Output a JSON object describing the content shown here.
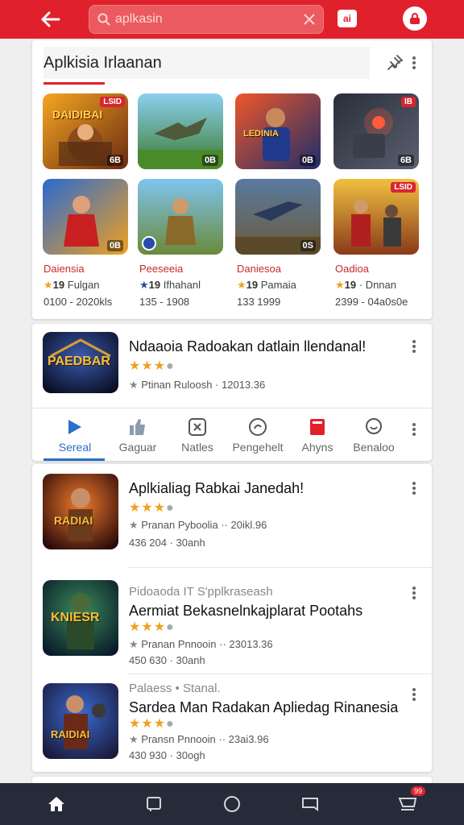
{
  "colors": {
    "brand": "#e0212b",
    "accent_blue": "#2a6fc9",
    "star": "#f0a020",
    "nav_bg": "#262b3a"
  },
  "header": {
    "back_icon": "arrow-left-icon",
    "search_value": "aplkasin",
    "ai_label": "ai"
  },
  "section": {
    "title": "Aplkisia Irlaanan",
    "games": [
      {
        "name": "Daiensia",
        "rating": "19",
        "rating_label": "Fulgan",
        "downloads": "0100 - 2020kls",
        "flag": "LSID",
        "count": "6B"
      },
      {
        "name": "Peeseeia",
        "rating": "19",
        "rating_label": "Ifhahanl",
        "downloads": "135 - 1908",
        "flag": "",
        "count": "0B"
      },
      {
        "name": "Daniesoa",
        "rating": "19",
        "rating_label": "Pamaia",
        "downloads": "133 1999",
        "flag": "",
        "count": "0B"
      },
      {
        "name": "Oadioa",
        "rating": "19",
        "rating_label": "· Dnnan",
        "downloads": "2399 - 04a0s0e",
        "flag": "IB",
        "count": "6B"
      },
      {
        "count": "0B",
        "flag": ""
      },
      {
        "count": "",
        "flag": ""
      },
      {
        "count": "0S",
        "flag": ""
      },
      {
        "count": "",
        "flag": "LSID"
      }
    ],
    "icon_texts": [
      "DAIDIBAI",
      "LEDINIA"
    ]
  },
  "featured": {
    "title": "Ndaaoia Radoakan datlain llendanal!",
    "meta": "Ptinan  Ruloosh · 12013.36",
    "icon_text": "PAEDBAR"
  },
  "tabs": [
    {
      "label": "Sereal",
      "icon": "play-store-icon"
    },
    {
      "label": "Gaguar",
      "icon": "thumbs-up-icon"
    },
    {
      "label": "Natles",
      "icon": "puzzle-icon"
    },
    {
      "label": "Pengehelt",
      "icon": "compass-icon"
    },
    {
      "label": "Ahyns",
      "icon": "book-icon"
    },
    {
      "label": "Benaloo",
      "icon": "chat-icon"
    }
  ],
  "apps": [
    {
      "title": "Aplkialiag Rabkai Janedah!",
      "subtitle": "",
      "meta1": "Pranan  Pyboolia  ·· 20ikl.96",
      "meta2": "436 204 · 30anh",
      "icon_text": "RADIAI"
    },
    {
      "subtitle": "Pidoaoda IT S'pplkraseash",
      "title": "Aermiat Bekasnelnkajplarat Pootahs",
      "meta1": "Pranan  Pnnooin  ·· 23013.36",
      "meta2": "450 630 · 30anh",
      "icon_text": "KNIESR"
    },
    {
      "subtitle": "Palaess • Stanal.",
      "title": "Sardea Man Radakan Apliedag Rinanesia",
      "meta1": "Pransn  Pnnooin  ·· 23ai3.96",
      "meta2": "430 930 · 30ogh",
      "icon_text": "RAIDIAI"
    }
  ],
  "bottom_nav": [
    {
      "icon": "home-icon"
    },
    {
      "icon": "square-icon"
    },
    {
      "icon": "circle-icon"
    },
    {
      "icon": "book-icon"
    },
    {
      "icon": "cart-icon",
      "badge": "99"
    }
  ]
}
